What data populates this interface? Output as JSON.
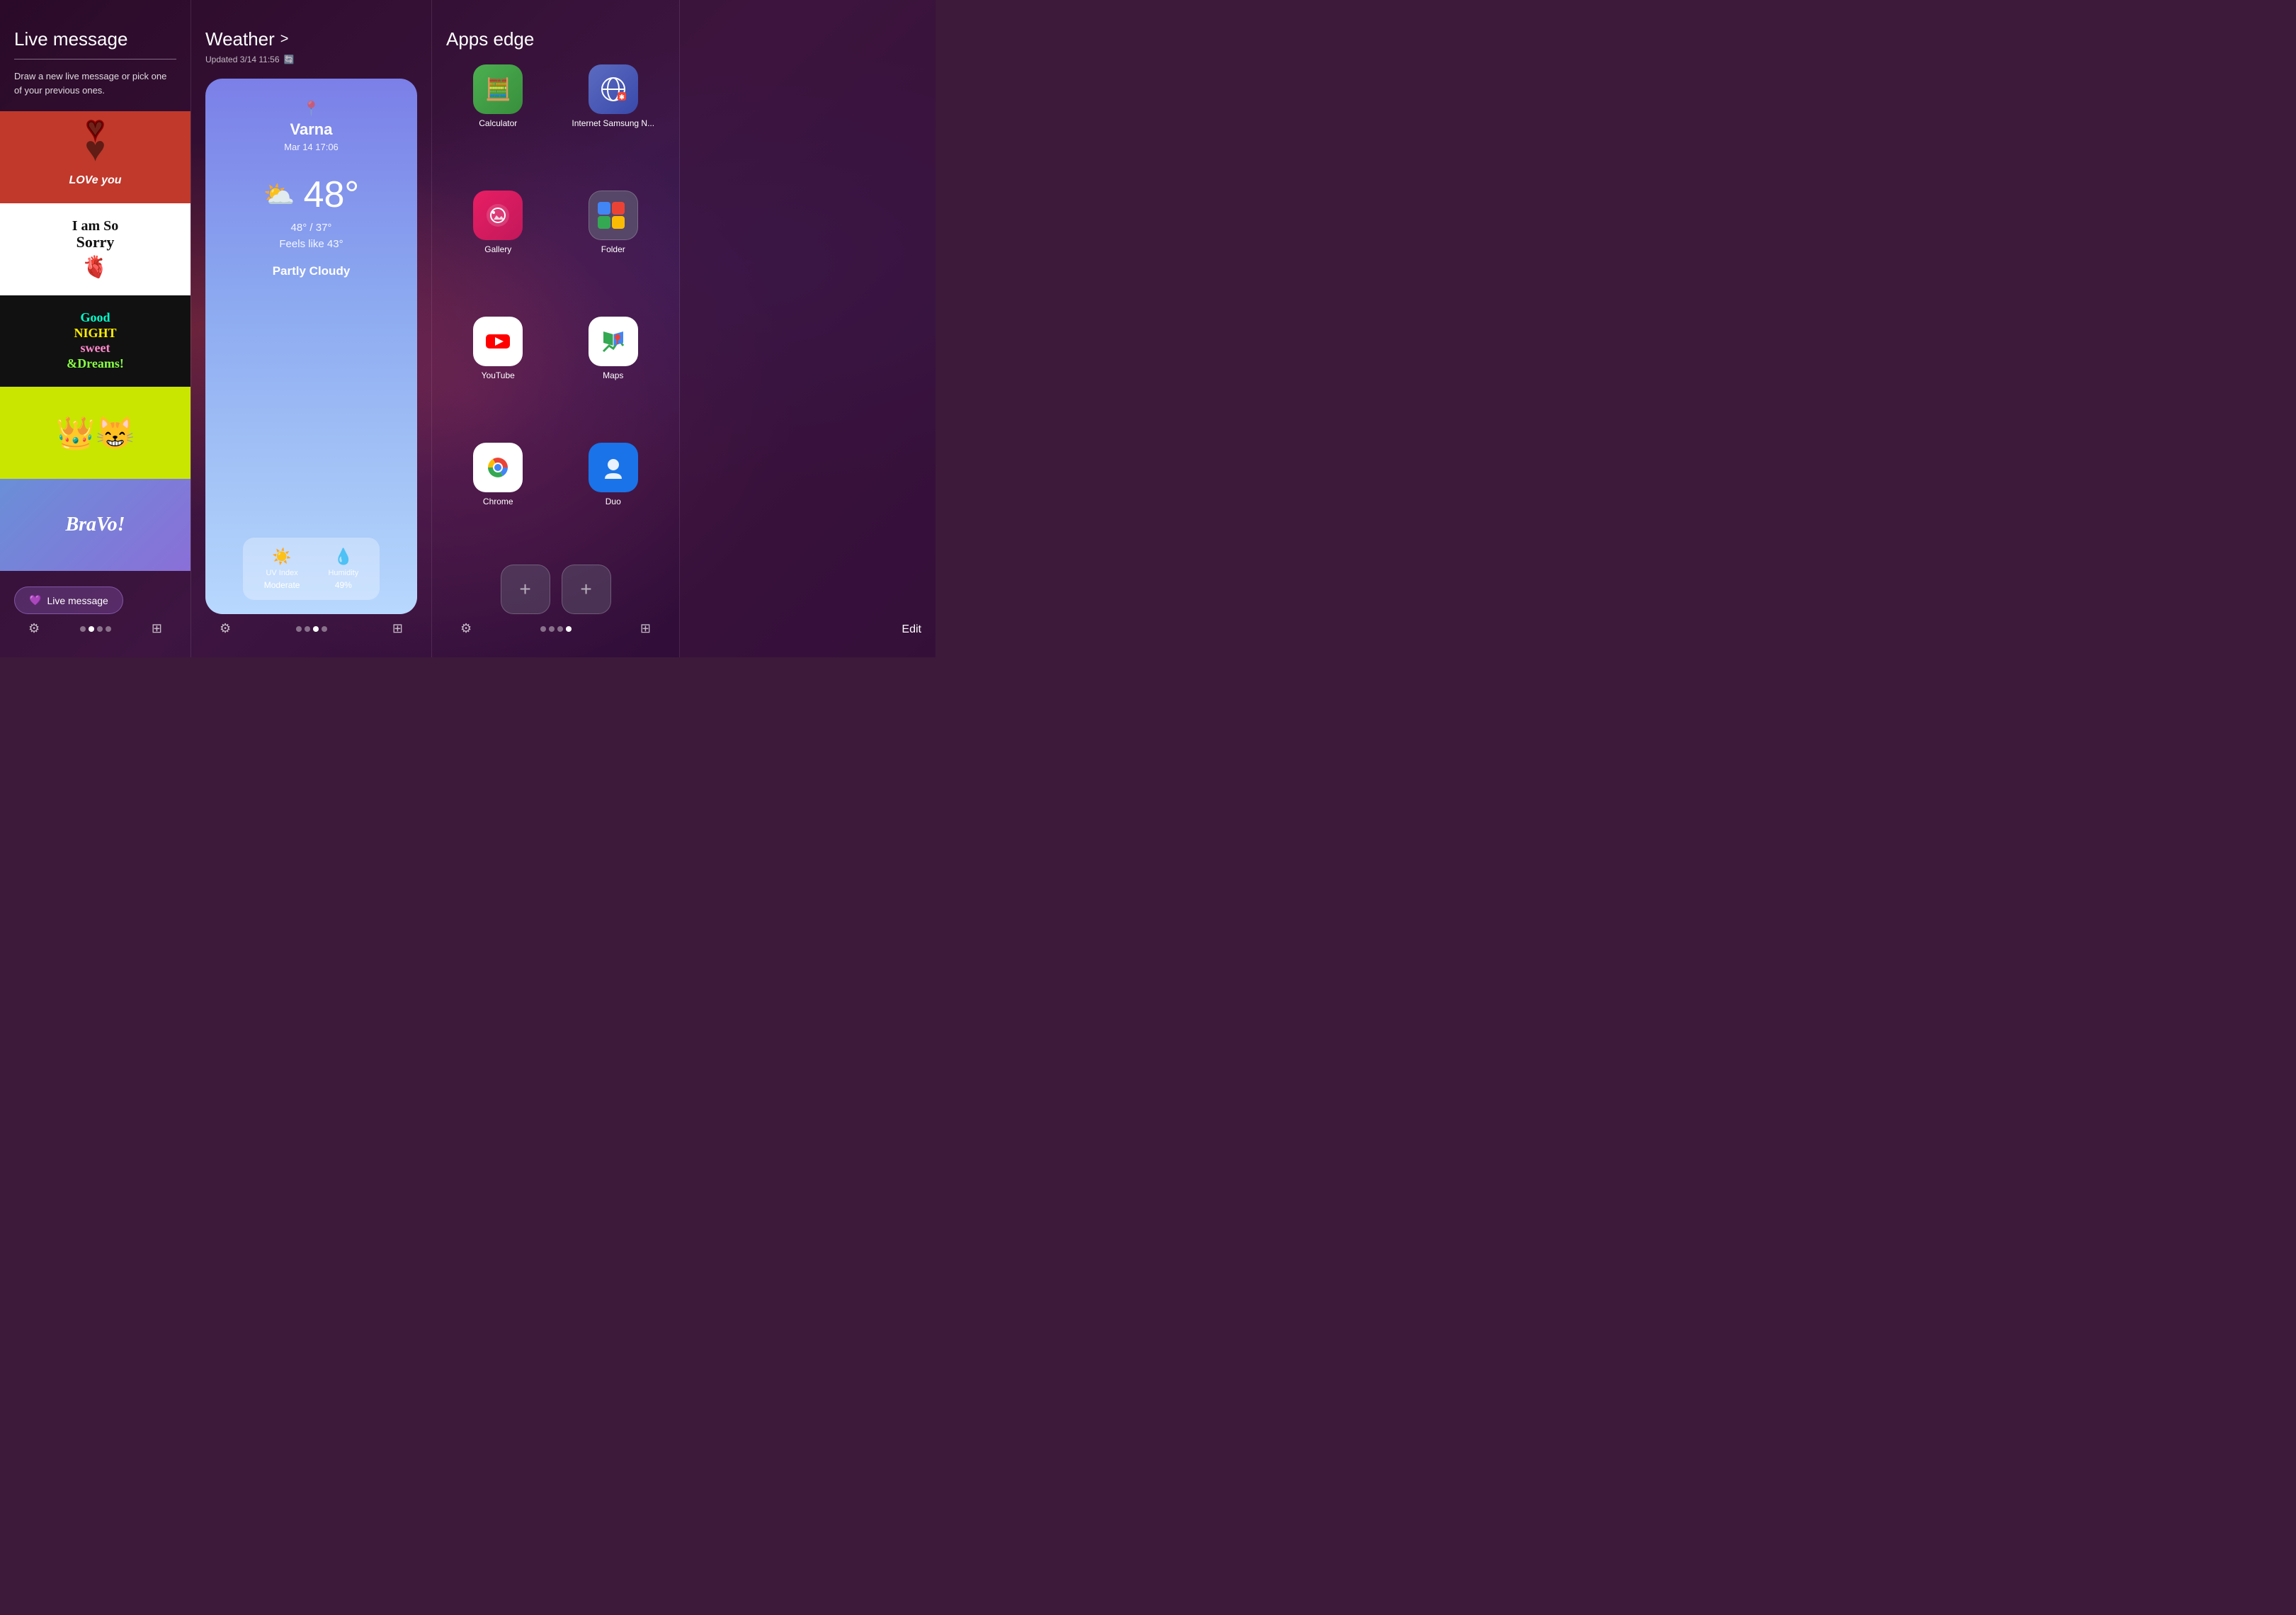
{
  "panel1": {
    "title": "Live message",
    "description": "Draw a new live message or pick one of your previous ones.",
    "button_label": "Live message",
    "images": [
      {
        "id": "love-you",
        "alt": "Love you"
      },
      {
        "id": "i-am-so-sorry",
        "alt": "I am So Sorry"
      },
      {
        "id": "goodnight",
        "alt": "Good Night Sweet & Dreams!"
      },
      {
        "id": "crown",
        "alt": "Crown character"
      },
      {
        "id": "bravo",
        "alt": "BraVo!"
      }
    ],
    "bottom": {
      "gear_label": "settings",
      "grid_label": "all apps"
    }
  },
  "panel2": {
    "title": "Weather",
    "chevron": ">",
    "updated": "Updated 3/14 11:56",
    "city": "Varna",
    "date": "Mar 14 17:06",
    "temp": "48°",
    "hi": "48°",
    "lo": "37°",
    "feels_like": "Feels like 43°",
    "condition": "Partly Cloudy",
    "uv_label": "UV Index",
    "uv_value": "Moderate",
    "humidity_label": "Humidity",
    "humidity_value": "49%"
  },
  "panel3": {
    "title": "Apps edge",
    "apps": [
      {
        "id": "calculator",
        "label": "Calculator",
        "icon_type": "calc"
      },
      {
        "id": "internet",
        "label": "Internet Samsung N...",
        "icon_type": "internet"
      },
      {
        "id": "gallery",
        "label": "Gallery",
        "icon_type": "gallery"
      },
      {
        "id": "folder",
        "label": "Folder",
        "icon_type": "folder"
      },
      {
        "id": "youtube",
        "label": "YouTube",
        "icon_type": "youtube"
      },
      {
        "id": "maps",
        "label": "Maps",
        "icon_type": "maps"
      },
      {
        "id": "chrome",
        "label": "Chrome",
        "icon_type": "chrome"
      },
      {
        "id": "duo",
        "label": "Duo",
        "icon_type": "duo"
      }
    ],
    "add_buttons": [
      "+",
      "+"
    ],
    "edit_label": "Edit"
  },
  "bottom_bars": {
    "panel1": {
      "dots": [
        false,
        true,
        false,
        false
      ],
      "active": 1
    },
    "panel2": {
      "dots": [
        false,
        false,
        true,
        false
      ],
      "active": 2
    },
    "panel3": {
      "dots": [
        false,
        false,
        false,
        true
      ],
      "active": 3
    }
  }
}
